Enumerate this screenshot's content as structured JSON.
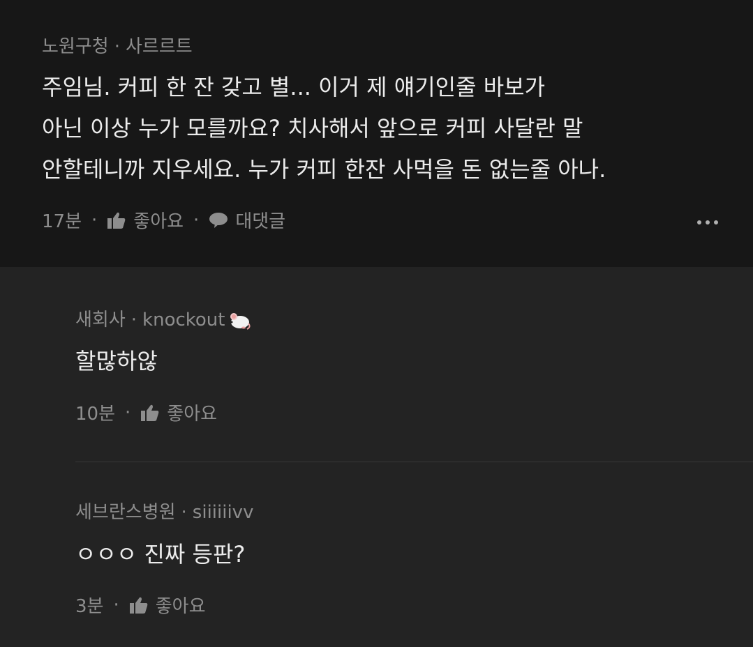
{
  "top_comment": {
    "author": "노원구청",
    "title": "사르르트",
    "lines": [
      "주임님. 커피 한 잔 갖고 별... 이거 제 얘기인줄 바보가",
      "아닌 이상 누가 모를까요? 치사해서 앞으로 커피 사달란 말",
      "안할테니까 지우세요. 누가 커피 한잔 사먹을 돈 없는줄 아나."
    ],
    "time": "17분",
    "like_label": "좋아요",
    "reply_label": "대댓글"
  },
  "replies": [
    {
      "author": "새회사",
      "title": "knockout",
      "text": "할많하않",
      "time": "10분",
      "like_label": "좋아요"
    },
    {
      "author": "세브란스병원",
      "title": "siiiiiivv",
      "text": "ㅇㅇㅇ 진짜 등판?",
      "time": "3분",
      "like_label": "좋아요"
    }
  ],
  "colors": {
    "top_bg": "#171717",
    "reply_bg": "#232323",
    "meta_text": "#8e8e8e",
    "body_text": "#ececec"
  },
  "icons": [
    "thumbs-up-icon",
    "speech-bubble-icon",
    "more-dots-icon",
    "mouse-emoji-icon"
  ]
}
